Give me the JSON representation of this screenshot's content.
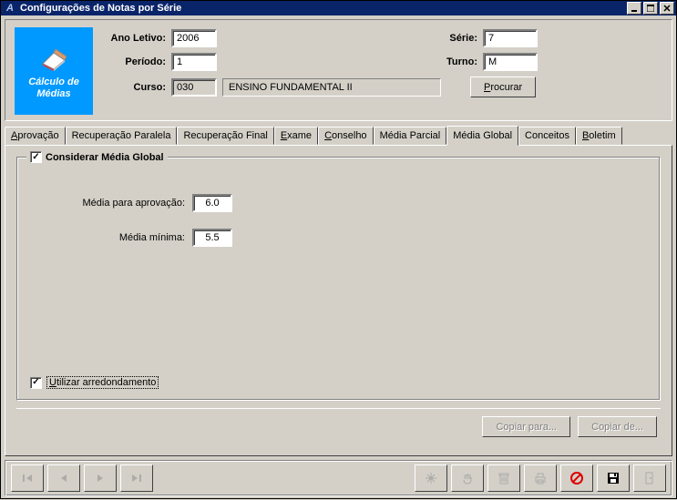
{
  "window": {
    "title": "Configurações de Notas por Série"
  },
  "tile": {
    "line1": "Cálculo de",
    "line2": "Médias"
  },
  "fields": {
    "ano_letivo_label": "Ano Letivo:",
    "ano_letivo": "2006",
    "periodo_label": "Período:",
    "periodo": "1",
    "serie_label": "Série:",
    "serie": "7",
    "turno_label": "Turno:",
    "turno": "M",
    "curso_label": "Curso:",
    "curso_code": "030",
    "curso_name": "ENSINO FUNDAMENTAL II"
  },
  "buttons": {
    "procurar_u": "P",
    "procurar_rest": "rocurar",
    "copiar_para": "Copiar para...",
    "copiar_de": "Copiar de..."
  },
  "tabs": {
    "aprovacao_u": "A",
    "aprovacao_rest": "provação",
    "rec_paralela": "Recuperação Paralela",
    "rec_final": "Recuperação Final",
    "exame_u": "E",
    "exame_rest": "xame",
    "conselho_u": "C",
    "conselho_rest": "onselho",
    "media_parcial": "Média Parcial",
    "media_global": "Média Global",
    "conceitos": "Conceitos",
    "boletim_u": "B",
    "boletim_rest": "oletim"
  },
  "group": {
    "title": "Considerar Média Global",
    "consider_checked": true,
    "media_aprov_label": "Média para aprovação:",
    "media_aprov": "6.0",
    "media_min_label": "Média mínima:",
    "media_min": "5.5",
    "arred_u": "U",
    "arred_rest": "tilizar arredondamento",
    "arred_checked": true
  }
}
